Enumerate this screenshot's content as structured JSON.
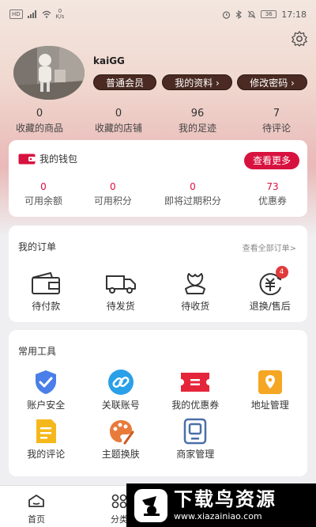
{
  "status_bar": {
    "network": "HD",
    "speed_value": "0",
    "speed_unit": "K/s",
    "battery": "36",
    "time": "17:18"
  },
  "profile": {
    "username": "kaiGG",
    "buttons": [
      {
        "label": "普通会员"
      },
      {
        "label": "我的资料 ›"
      },
      {
        "label": "修改密码 ›"
      }
    ],
    "stats": [
      {
        "value": "0",
        "label": "收藏的商品"
      },
      {
        "value": "0",
        "label": "收藏的店铺"
      },
      {
        "value": "96",
        "label": "我的足迹"
      },
      {
        "value": "7",
        "label": "待评论"
      }
    ]
  },
  "wallet": {
    "title": "我的钱包",
    "more_label": "查看更多",
    "accent": "#d8123f",
    "items": [
      {
        "value": "0",
        "label": "可用余额"
      },
      {
        "value": "0",
        "label": "可用积分"
      },
      {
        "value": "0",
        "label": "即将过期积分"
      },
      {
        "value": "73",
        "label": "优惠券"
      }
    ]
  },
  "orders": {
    "title": "我的订单",
    "all_link": "查看全部订单>",
    "items": [
      {
        "label": "待付款",
        "icon": "wallet-icon"
      },
      {
        "label": "待发货",
        "icon": "truck-icon"
      },
      {
        "label": "待收货",
        "icon": "flower-icon"
      },
      {
        "label": "退换/售后",
        "icon": "refund-icon",
        "badge": "4"
      }
    ]
  },
  "tools": {
    "title": "常用工具",
    "items": [
      {
        "label": "账户安全",
        "icon": "shield-check-icon",
        "color": "#4a7ee8"
      },
      {
        "label": "关联账号",
        "icon": "link-icon",
        "color": "#2aa0e8"
      },
      {
        "label": "我的优惠券",
        "icon": "coupon-icon",
        "color": "#e5263a"
      },
      {
        "label": "地址管理",
        "icon": "location-icon",
        "color": "#f5a623"
      },
      {
        "label": "我的评论",
        "icon": "review-icon",
        "color": "#f5b81c"
      },
      {
        "label": "主题换肤",
        "icon": "palette-icon",
        "color": "#e87a3a"
      },
      {
        "label": "商家管理",
        "icon": "merchant-icon",
        "color": "#4a6fa8"
      }
    ]
  },
  "tabbar": {
    "items": [
      {
        "label": "首页",
        "icon": "home-icon"
      },
      {
        "label": "分类",
        "icon": "grid-icon"
      }
    ]
  },
  "watermark": {
    "title": "下载鸟资源",
    "url": "www.xiazainiao.com"
  }
}
